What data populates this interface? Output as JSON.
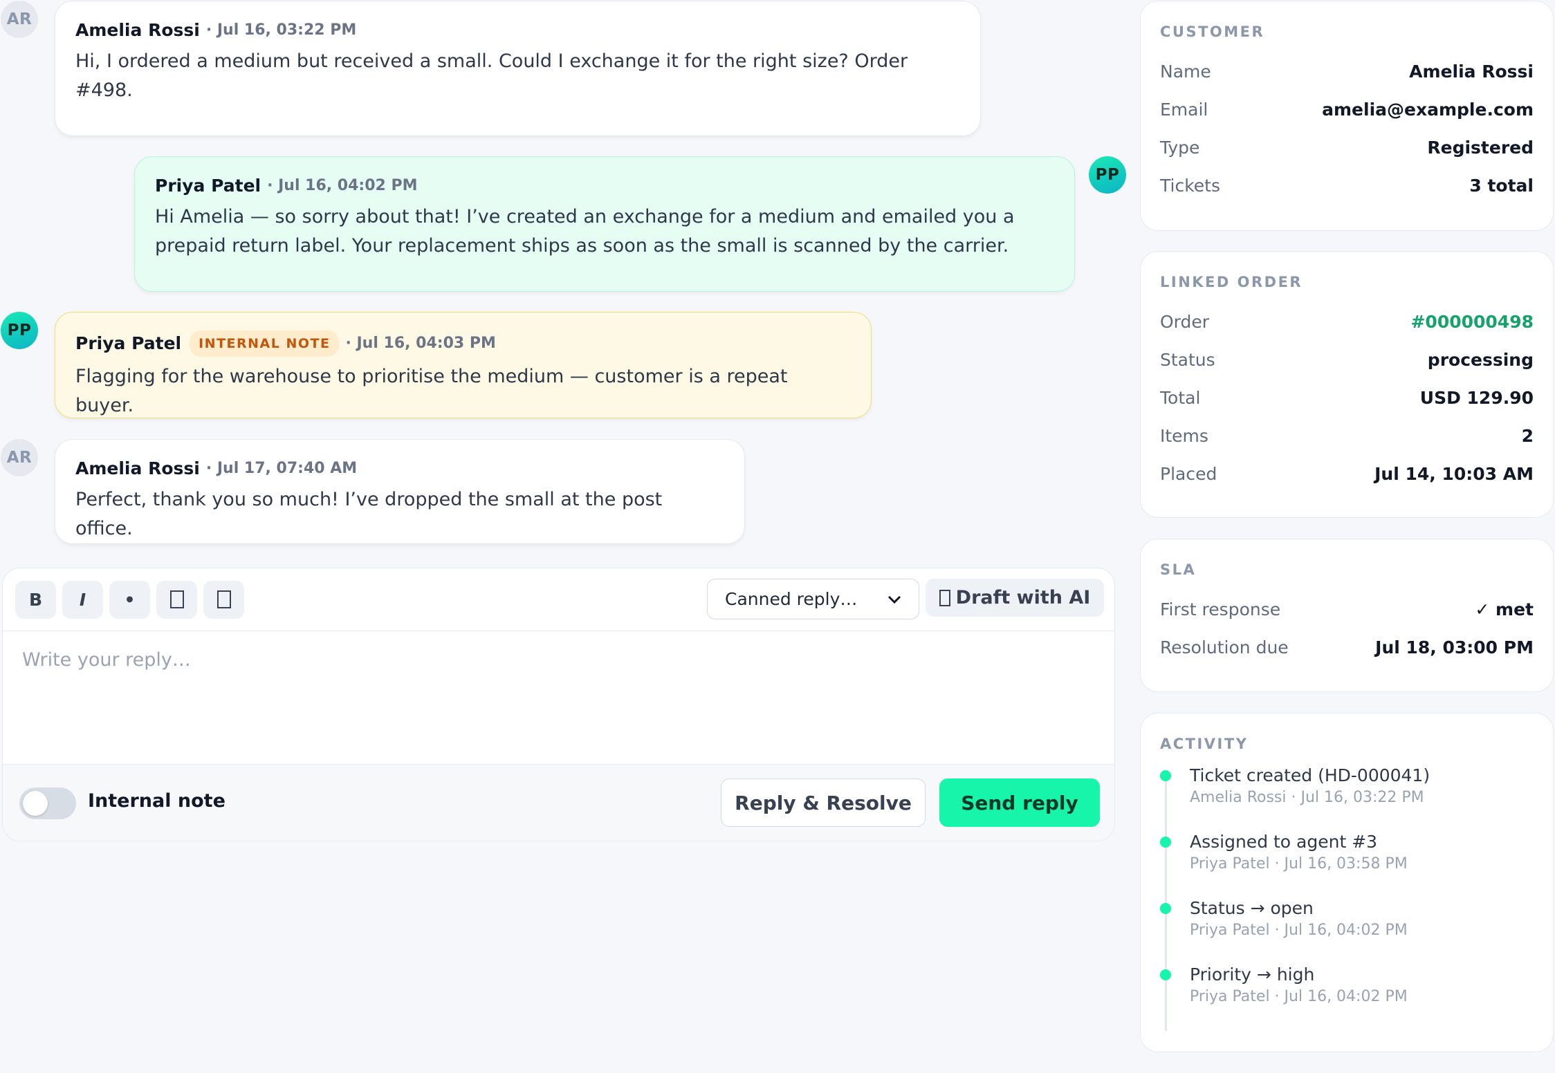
{
  "messages": [
    {
      "initials": "AR",
      "author": "Amelia Rossi",
      "meta": "· Jul 16, 03:22 PM",
      "body": "Hi, I ordered a medium but received a small. Could I exchange it for the right size? Order #498."
    },
    {
      "initials": "PP",
      "author": "Priya Patel",
      "meta": "· Jul 16, 04:02 PM",
      "body": "Hi Amelia — so sorry about that! I’ve created an exchange for a medium and emailed you a prepaid return label. Your replacement ships as soon as the small is scanned by the carrier."
    },
    {
      "initials": "PP",
      "author": "Priya Patel",
      "badge": "INTERNAL NOTE",
      "meta": "· Jul 16, 04:03 PM",
      "body": "Flagging for the warehouse to prioritise the medium — customer is a repeat buyer."
    },
    {
      "initials": "AR",
      "author": "Amelia Rossi",
      "meta": "· Jul 17, 07:40 AM",
      "body": "Perfect, thank you so much! I’ve dropped the small at the post office."
    }
  ],
  "composer": {
    "toolbar": {
      "bold": "B",
      "italic": "I",
      "bullet": "•",
      "link_icon": "link-icon",
      "image_icon": "image-icon",
      "canned_reply": "Canned reply…",
      "draft_ai": "Draft with AI",
      "draft_ai_icon": "sparkle-icon"
    },
    "placeholder": "Write your reply…",
    "internal_note_label": "Internal note",
    "internal_note_on": false,
    "reply_resolve": "Reply & Resolve",
    "send_reply": "Send reply"
  },
  "customer": {
    "title": "CUSTOMER",
    "rows": [
      {
        "k": "Name",
        "v": "Amelia Rossi"
      },
      {
        "k": "Email",
        "v": "amelia@example.com"
      },
      {
        "k": "Type",
        "v": "Registered"
      },
      {
        "k": "Tickets",
        "v": "3 total"
      }
    ]
  },
  "linked_order": {
    "title": "LINKED ORDER",
    "rows": [
      {
        "k": "Order",
        "v": "#000000498"
      },
      {
        "k": "Status",
        "v": "processing"
      },
      {
        "k": "Total",
        "v": "USD 129.90"
      },
      {
        "k": "Items",
        "v": "2"
      },
      {
        "k": "Placed",
        "v": "Jul 14, 10:03 AM"
      }
    ]
  },
  "sla": {
    "title": "SLA",
    "rows": [
      {
        "k": "First response",
        "v": "✓ met"
      },
      {
        "k": "Resolution due",
        "v": "Jul 18, 03:00 PM"
      }
    ]
  },
  "activity": {
    "title": "ACTIVITY",
    "items": [
      {
        "title": "Ticket created (HD-000041)",
        "meta": "Amelia Rossi · Jul 16, 03:22 PM"
      },
      {
        "title": "Assigned to agent #3",
        "meta": "Priya Patel · Jul 16, 03:58 PM"
      },
      {
        "title": "Status → open",
        "meta": "Priya Patel · Jul 16, 04:02 PM"
      },
      {
        "title": "Priority → high",
        "meta": "Priya Patel · Jul 16, 04:02 PM"
      }
    ]
  },
  "colors": {
    "accent": "#16f5a9",
    "link": "#16a36b",
    "note_bg": "#fef9e5",
    "agent_bg": "#e6fdf4"
  }
}
